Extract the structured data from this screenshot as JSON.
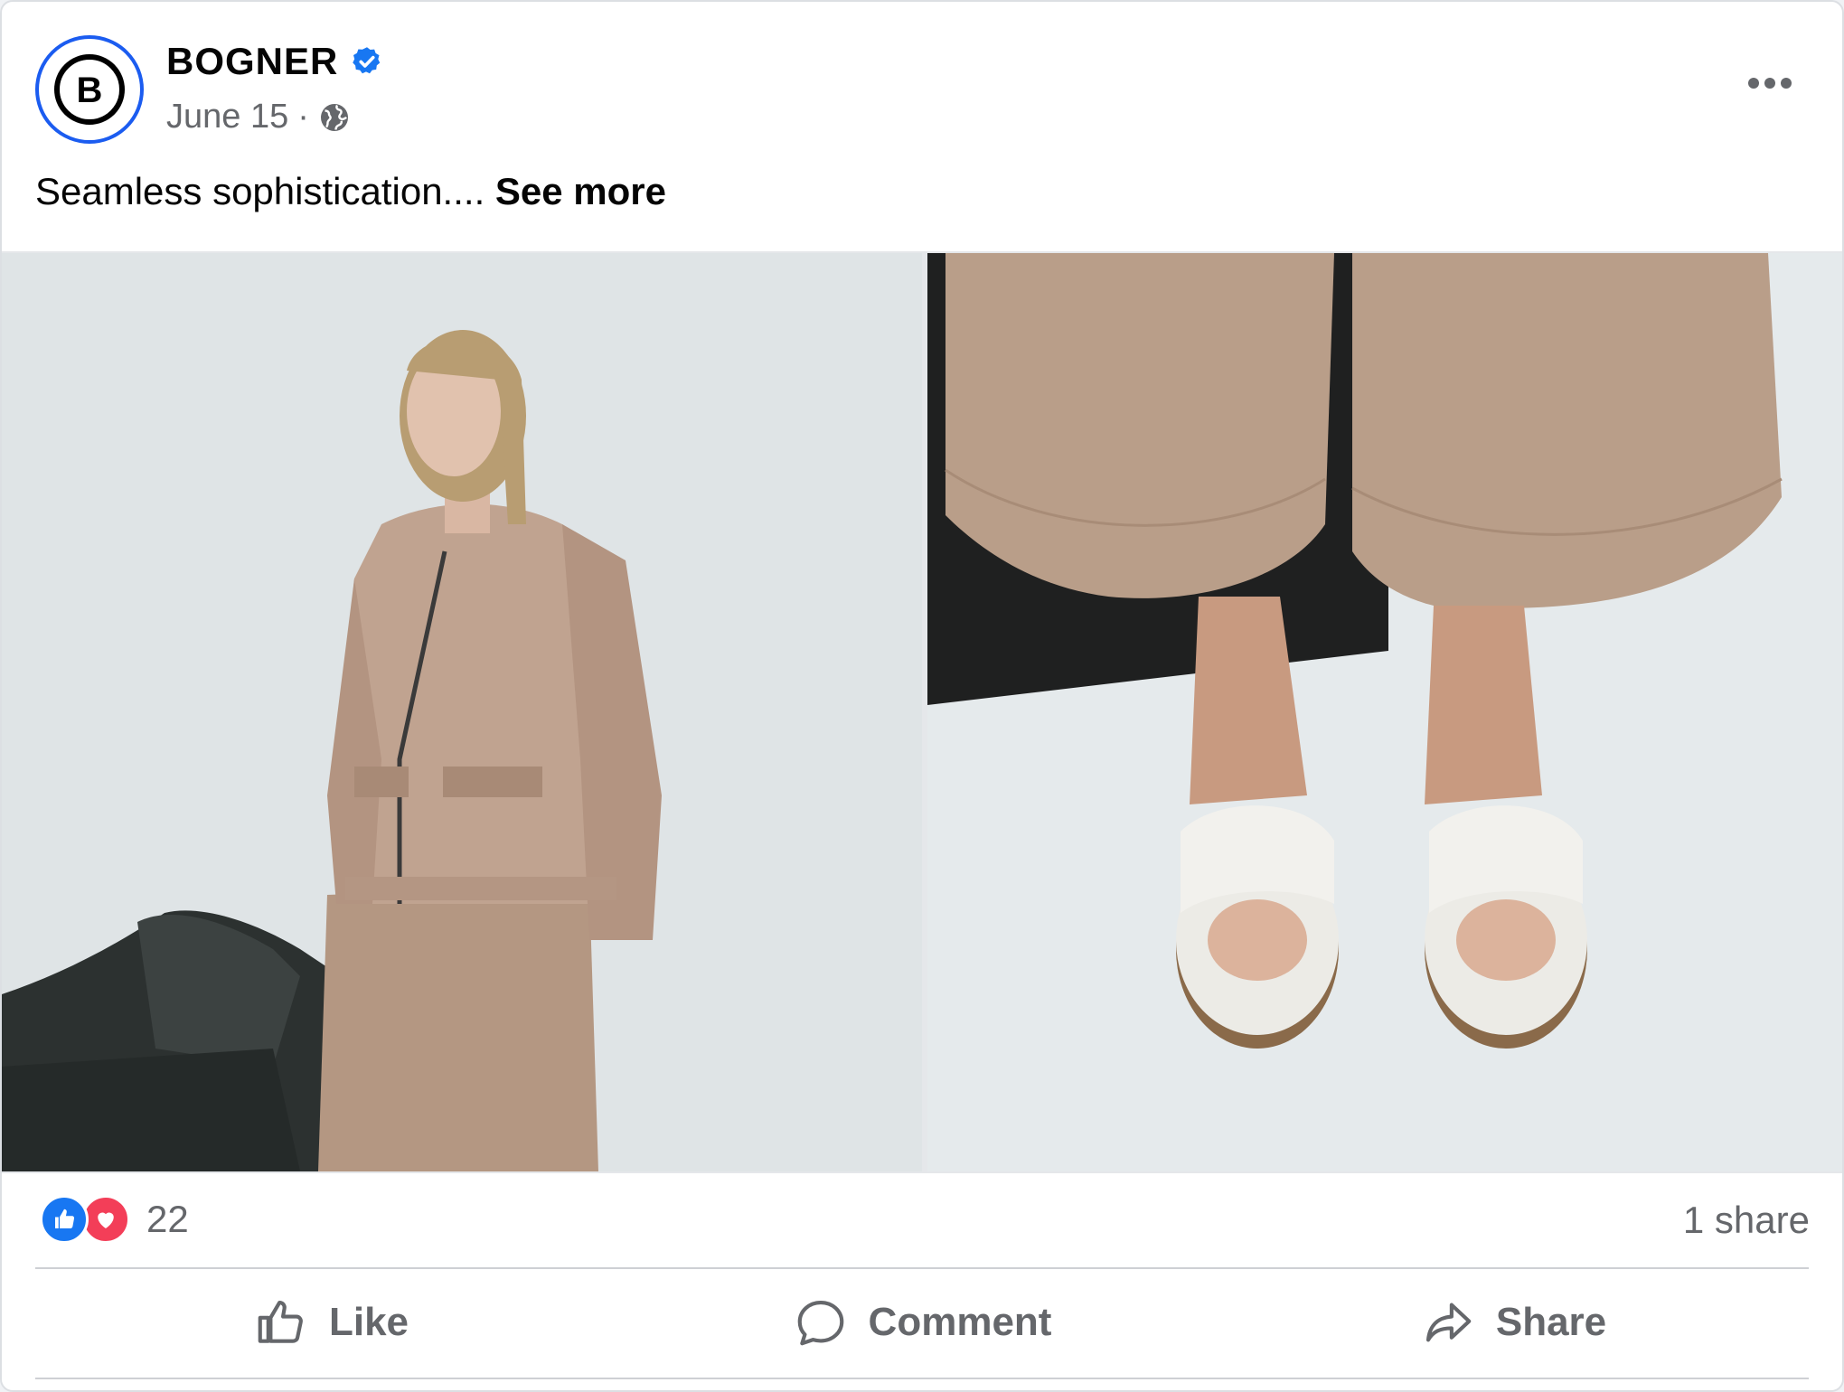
{
  "post": {
    "page_name": "BOGNER",
    "verified": true,
    "date": "June 15",
    "separator": "·",
    "privacy_icon": "globe-icon",
    "more_icon": "more-horizontal-icon",
    "caption_text": "Seamless sophistication.... ",
    "see_more_label": "See more",
    "avatar_letter": "B"
  },
  "media": [
    {
      "description_icon": "photo",
      "subject": "model in beige zip jacket and cargo trousers beside black leather sofa"
    },
    {
      "description_icon": "photo",
      "subject": "feet in white crossover slide sandals under beige wide trousers"
    }
  ],
  "stats": {
    "reaction_types": [
      "like",
      "love"
    ],
    "reaction_count": "22",
    "shares": "1 share"
  },
  "actions": [
    {
      "label": "Like",
      "icon": "thumbs-up-icon"
    },
    {
      "label": "Comment",
      "icon": "comment-icon"
    },
    {
      "label": "Share",
      "icon": "share-icon"
    }
  ],
  "colors": {
    "brand_blue": "#1877f2",
    "avatar_ring": "#1b5cf0",
    "love_red": "#f33e58",
    "text_primary": "#050505",
    "text_secondary": "#65676b"
  }
}
